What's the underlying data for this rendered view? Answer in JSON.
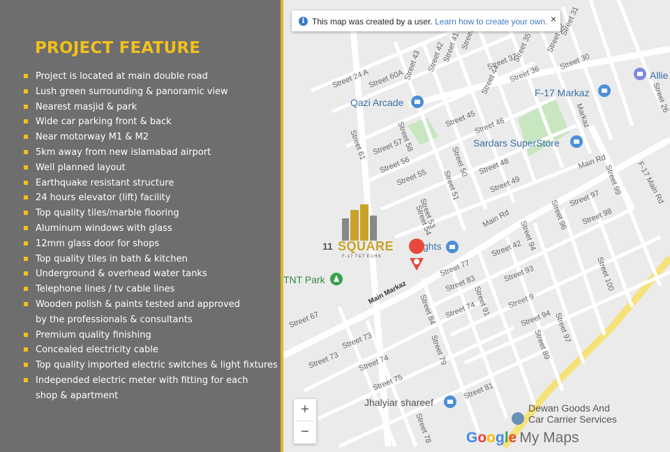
{
  "feature_panel": {
    "title": "PROJECT FEATURE",
    "items": [
      "Project is located at main double road",
      "Lush green surrounding & panoramic view",
      "Nearest masjid & park",
      "Wide car parking front & back",
      "Near motorway M1 & M2",
      "5km away from new islamabad airport",
      "Well planned layout",
      "Earthquake resistant structure",
      "24 hours elevator (lift) facility",
      "Top quality tiles/marble flooring",
      "Aluminum windows with glass",
      "12mm glass door for shops",
      "Top quality tiles in bath & kitchen",
      "Underground & overhead water tanks",
      "Telephone lines / tv cable lines",
      "Wooden polish & paints tested and approved",
      "by the professionals & consultants",
      "Premium quality finishing",
      "Concealed electricity cable",
      "Top quality imported electric switches & light fixtures",
      "Independed electric meter with fitting for each",
      "shop & apartment"
    ]
  },
  "notice": {
    "message": "This map was created by a user.",
    "link": "Learn how to create your own.",
    "close": "×"
  },
  "map": {
    "places": {
      "qazi": "Qazi Arcade",
      "sardars": "Sardars SuperStore",
      "f17markaz": "F-17 Markaz",
      "allie": "Allie",
      "tnt": "TNT Park",
      "jhalyiar": "Jhalyiar shareef",
      "dewan1": "Dewan Goods And",
      "dewan2": "Car Carrier Services",
      "heights": "ghts",
      "main_markaz": "Main Markaz",
      "main_rd": "Main Rd",
      "f17_main_rd": "F-17 Main Rd"
    },
    "streets": [
      "Street 24 A",
      "Street 60A",
      "Street 43",
      "Street 42",
      "Street 41",
      "Street 40",
      "Street 37",
      "Street 36",
      "Street 35",
      "Street 32",
      "Street 31",
      "Street 30",
      "Street 45",
      "Street 46",
      "Street 44",
      "Street 57",
      "Street 58",
      "Street 56",
      "Street 55",
      "Street 61",
      "Street 50",
      "Street 48",
      "Street 49",
      "Street 51",
      "Street 53",
      "Street 54",
      "Street 97",
      "Street 98",
      "Street 99",
      "Street 96",
      "Street 94",
      "Street 42",
      "Street 77",
      "Street 83",
      "Street 93",
      "Street 74",
      "Street 91",
      "Street 9",
      "Street 100",
      "Street 84",
      "Street 67",
      "Street 73",
      "Street 73",
      "Street 74",
      "Street 79",
      "Street 94",
      "Street 97",
      "Street 89",
      "Street 75",
      "Street 81",
      "Street 78",
      "Markaz",
      "Street 26"
    ],
    "zoom_in": "+",
    "zoom_out": "−",
    "attribution_google": "Google",
    "attribution_mymaps": "My Maps",
    "road_color": "#ffffff",
    "highway_color": "#f5e27a",
    "park_color": "#c8e6c0"
  },
  "logo": {
    "number": "11",
    "name": "SQUARE",
    "subtitle": "F-17 T&T ECHS"
  }
}
